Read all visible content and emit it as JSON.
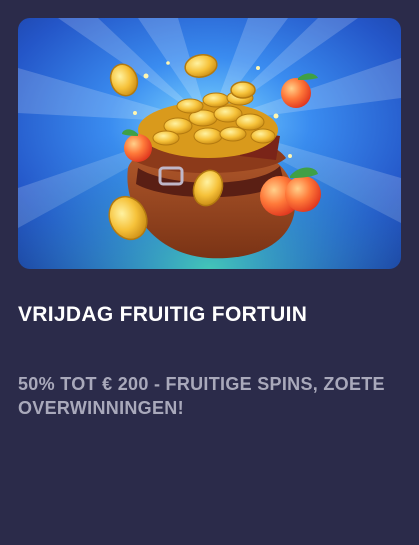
{
  "promo": {
    "image_alt": "Pot of gold coins with peaches",
    "title": "VRIJDAG FRUITIG FORTUIN",
    "description": "50% TOT € 200 - FRUITIGE SPINS, ZOETE OVERWINNINGEN!"
  },
  "colors": {
    "background": "#2b2b4a",
    "title": "#ffffff",
    "description": "#a9a9bb",
    "banner_blue": "#2a6fe0"
  }
}
